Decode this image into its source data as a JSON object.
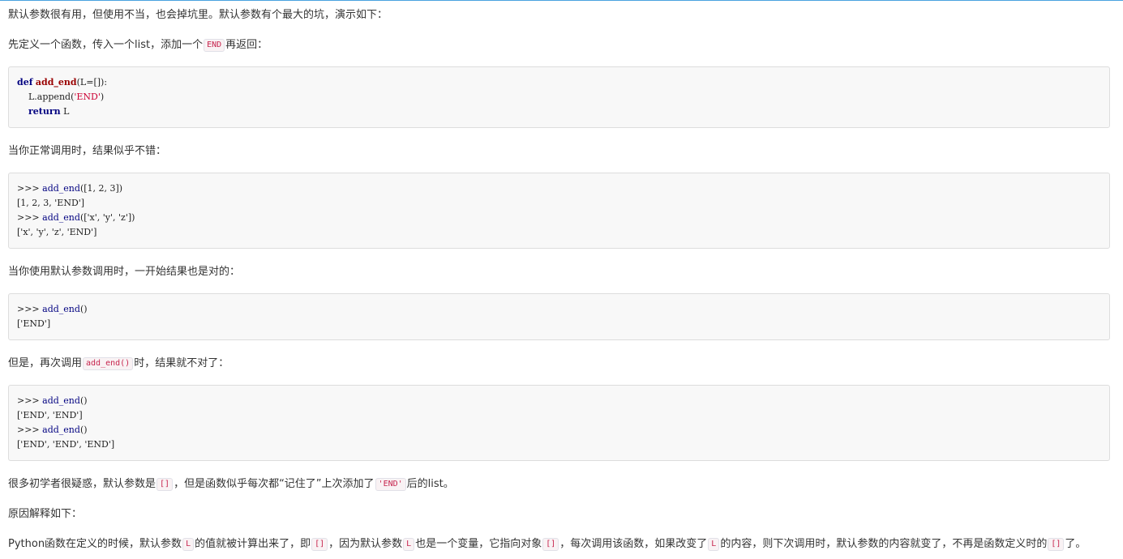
{
  "paragraphs": {
    "intro": "默认参数很有用，但使用不当，也会掉坑里。默认参数有个最大的坑，演示如下：",
    "define_before": "先定义一个函数，传入一个list，添加一个",
    "define_code": "END",
    "define_after": "再返回：",
    "normal_call": "当你正常调用时，结果似乎不错：",
    "default_call": "当你使用默认参数调用时，一开始结果也是对的：",
    "again_before": "但是，再次调用",
    "again_code": "add_end()",
    "again_after": "时，结果就不对了：",
    "confused_before": "很多初学者很疑惑，默认参数是",
    "confused_code1": "[]",
    "confused_mid": "，但是函数似乎每次都“记住了”上次添加了",
    "confused_code2": "'END'",
    "confused_after": "后的list。",
    "reason_title": "原因解释如下：",
    "expl_1": "Python函数在定义的时候，默认参数",
    "expl_code_L1": "L",
    "expl_2": "的值就被计算出来了，即",
    "expl_code_empty1": "[]",
    "expl_3": "，因为默认参数",
    "expl_code_L2": "L",
    "expl_4": "也是一个变量，它指向对象",
    "expl_code_empty2": "[]",
    "expl_5": "，每次调用该函数，如果改变了",
    "expl_code_L3": "L",
    "expl_6": "的内容，则下次调用时，默认参数的内容就变了，不再是函数定义时的",
    "expl_code_empty3": "[]",
    "expl_7": "了。"
  },
  "code_blocks": {
    "def_block": {
      "l1_kw": "def",
      "l1_name": "add_end",
      "l1_rest": "(L=[]):",
      "l2_pre": "    L.append(",
      "l2_str": "'END'",
      "l2_post": ")",
      "l3_kw": "return",
      "l3_rest": " L"
    },
    "normal_block": {
      "l1_prompt": ">>> ",
      "l1_fn": "add_end",
      "l1_rest": "([1, 2, 3])",
      "l2": "[1, 2, 3, 'END']",
      "l3_prompt": ">>> ",
      "l3_fn": "add_end",
      "l3_rest": "(['x', 'y', 'z'])",
      "l4": "['x', 'y', 'z', 'END']"
    },
    "default_block": {
      "l1_prompt": ">>> ",
      "l1_fn": "add_end",
      "l1_rest": "()",
      "l2": "['END']"
    },
    "again_block": {
      "l1_prompt": ">>> ",
      "l1_fn": "add_end",
      "l1_rest": "()",
      "l2": "['END', 'END']",
      "l3_prompt": ">>> ",
      "l3_fn": "add_end",
      "l3_rest": "()",
      "l4": "['END', 'END', 'END']"
    }
  },
  "colors": {
    "text": "#333333",
    "inline_code": "#c7254e",
    "keyword": "#000080",
    "function_name": "#990000",
    "string": "#cc0033",
    "top_border": "#4aa3df"
  }
}
